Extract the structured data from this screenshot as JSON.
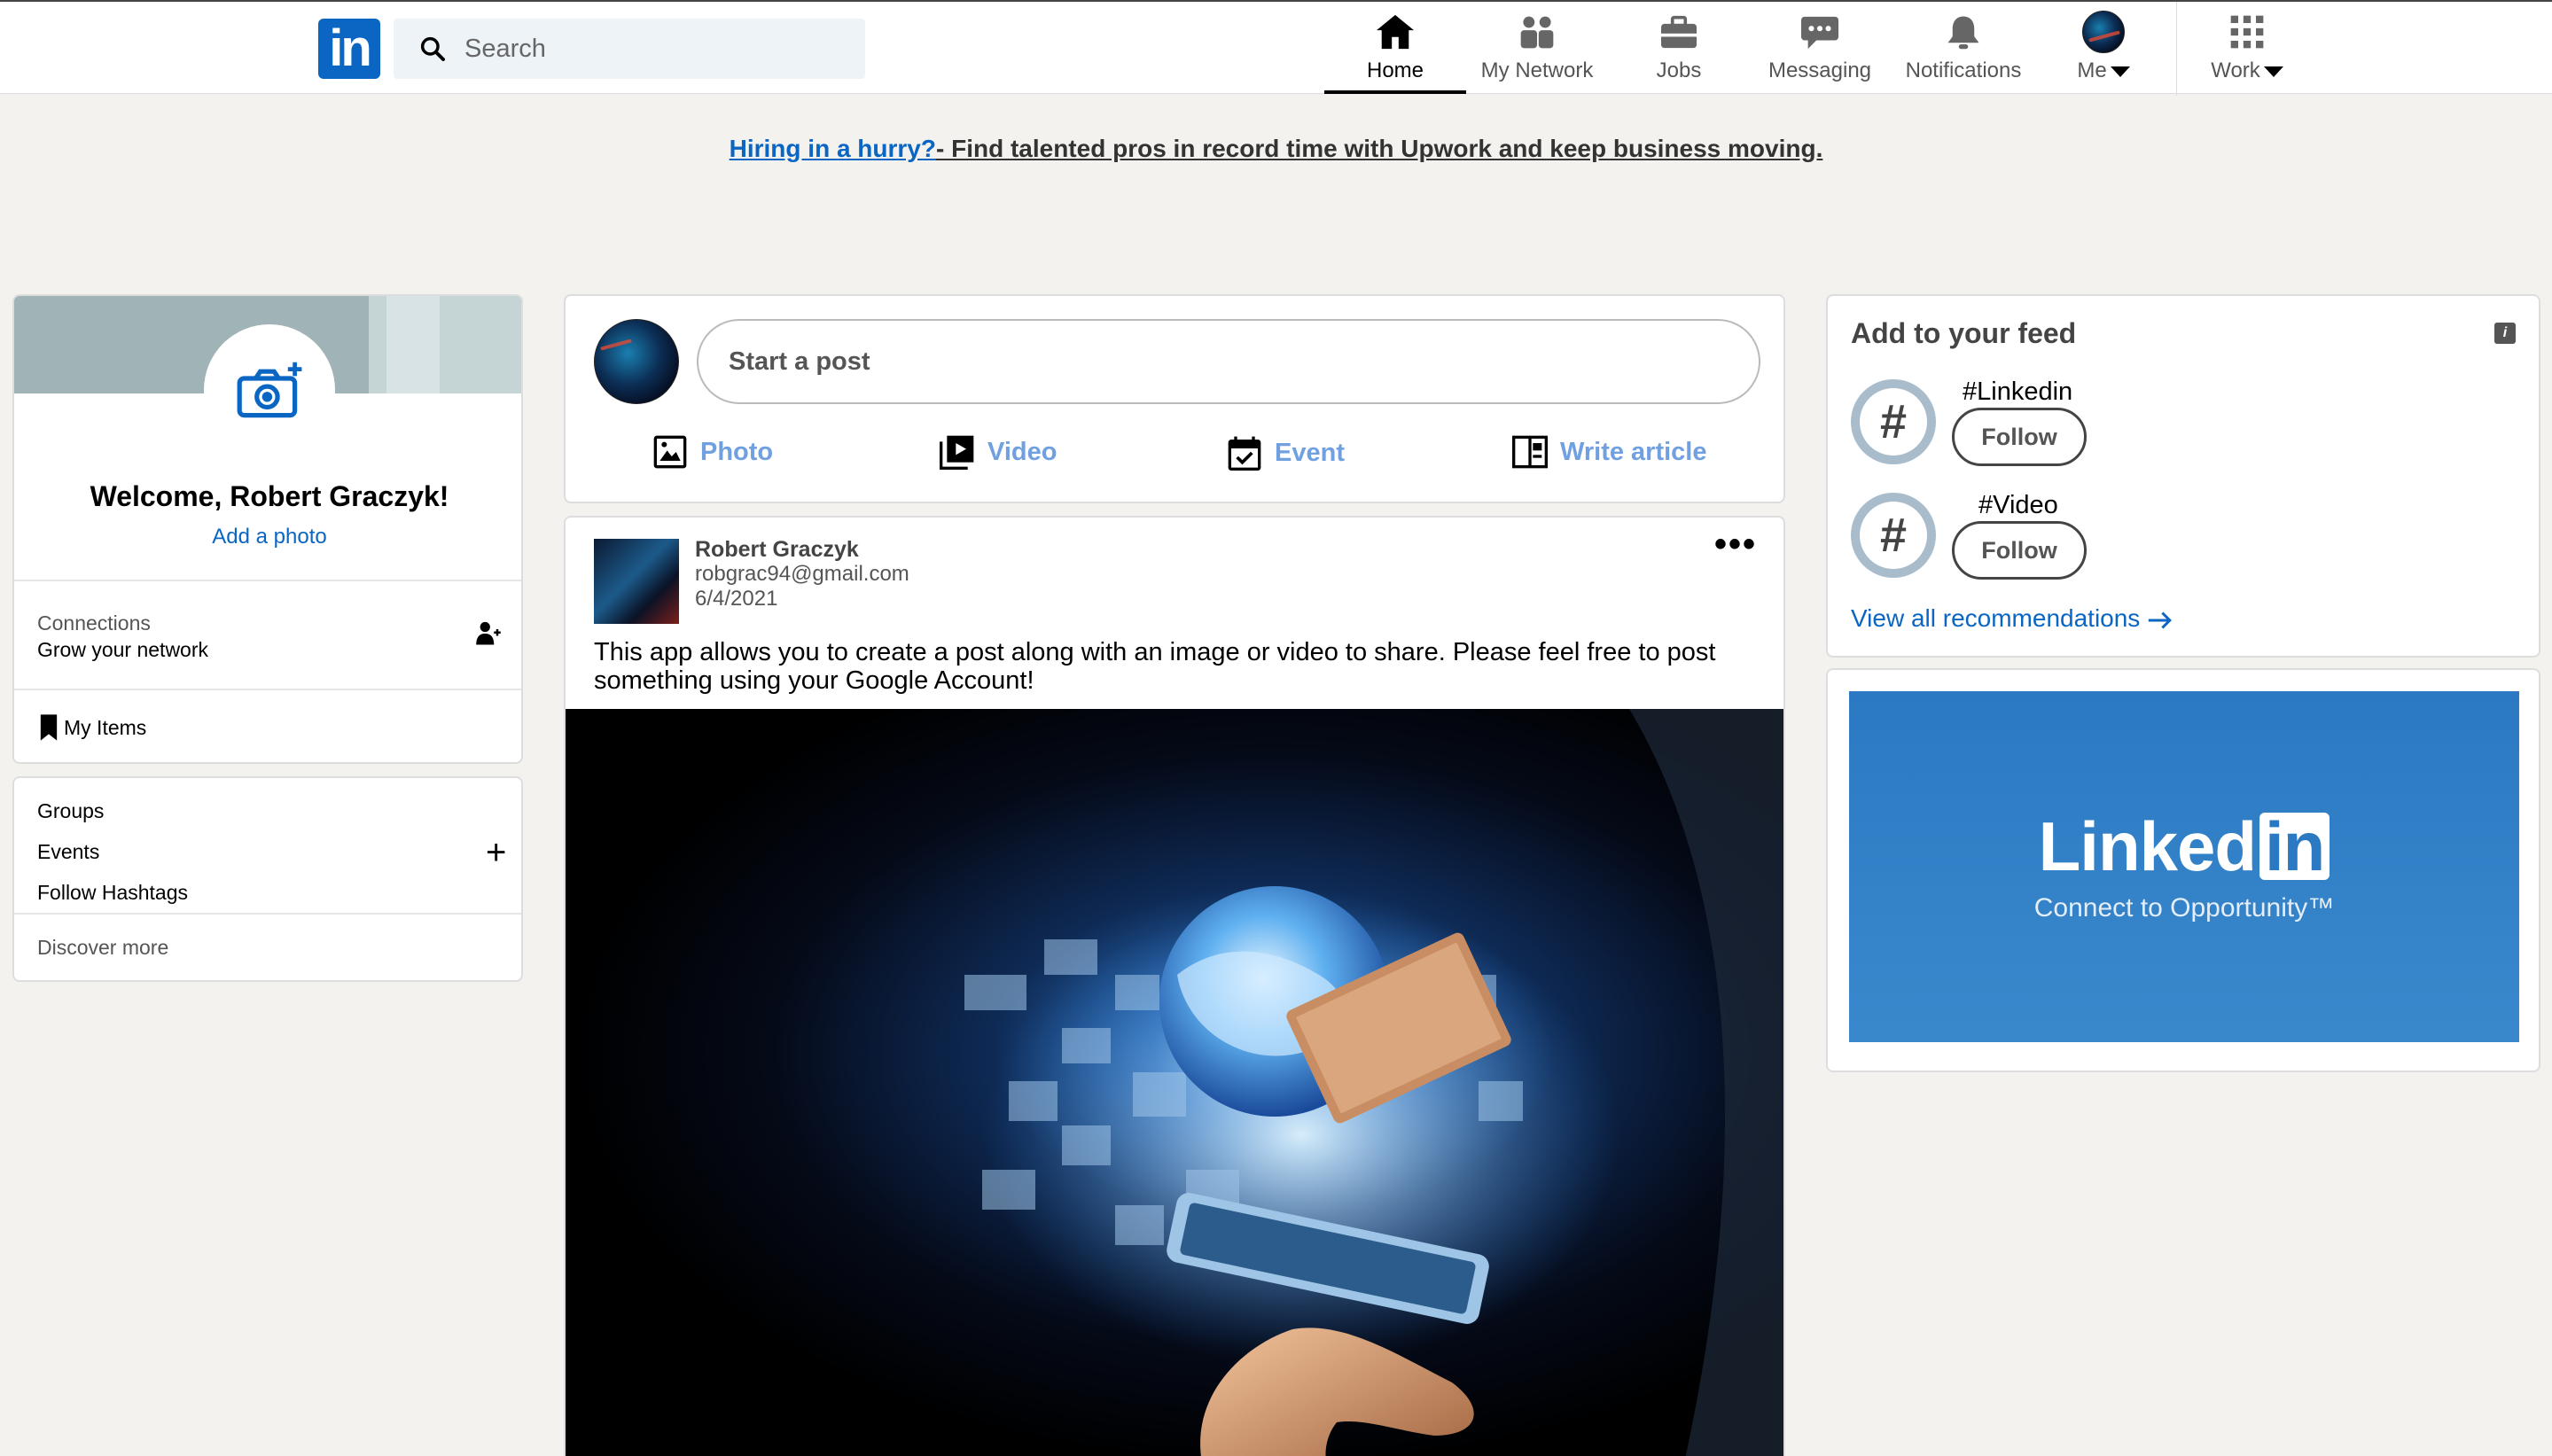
{
  "nav": {
    "logo_text": "in",
    "search_placeholder": "Search",
    "items": [
      {
        "label": "Home",
        "icon": "home-icon"
      },
      {
        "label": "My Network",
        "icon": "network-icon"
      },
      {
        "label": "Jobs",
        "icon": "briefcase-icon"
      },
      {
        "label": "Messaging",
        "icon": "messaging-icon"
      },
      {
        "label": "Notifications",
        "icon": "bell-icon"
      },
      {
        "label": "Me",
        "icon": "avatar"
      },
      {
        "label": "Work",
        "icon": "grid-icon"
      }
    ],
    "active": "Home"
  },
  "ad_banner": {
    "highlight": "Hiring in a hurry?",
    "rest": "- Find talented pros in record time with Upwork and keep business moving."
  },
  "profile": {
    "welcome": "Welcome, Robert Graczyk!",
    "add_photo": "Add a photo",
    "connections_label": "Connections",
    "connections_sub": "Grow your network",
    "my_items": "My Items"
  },
  "groups": {
    "items": [
      "Groups",
      "Events",
      "Follow Hashtags"
    ],
    "discover": "Discover more"
  },
  "start_post": {
    "placeholder": "Start a post",
    "actions": [
      {
        "label": "Photo",
        "icon": "photo-icon"
      },
      {
        "label": "Video",
        "icon": "video-icon"
      },
      {
        "label": "Event",
        "icon": "calendar-icon"
      },
      {
        "label": "Write article",
        "icon": "article-icon"
      }
    ]
  },
  "post": {
    "author": "Robert Graczyk",
    "email": "robgrac94@gmail.com",
    "date": "6/4/2021",
    "text": "This app allows you to create a post along with an image or video to share. Please feel free to post something using your Google Account!"
  },
  "feed": {
    "title": "Add to your feed",
    "hashtags": [
      {
        "tag": "#Linkedin",
        "button": "Follow"
      },
      {
        "tag": "#Video",
        "button": "Follow"
      }
    ],
    "view_all": "View all recommendations"
  },
  "ad_card": {
    "brand_left": "Linked",
    "brand_right": "in",
    "tagline": "Connect to Opportunity™"
  },
  "colors": {
    "brand_blue": "#0a66c2",
    "page_bg": "#f3f2ef",
    "action_blue": "#70a0e0"
  }
}
